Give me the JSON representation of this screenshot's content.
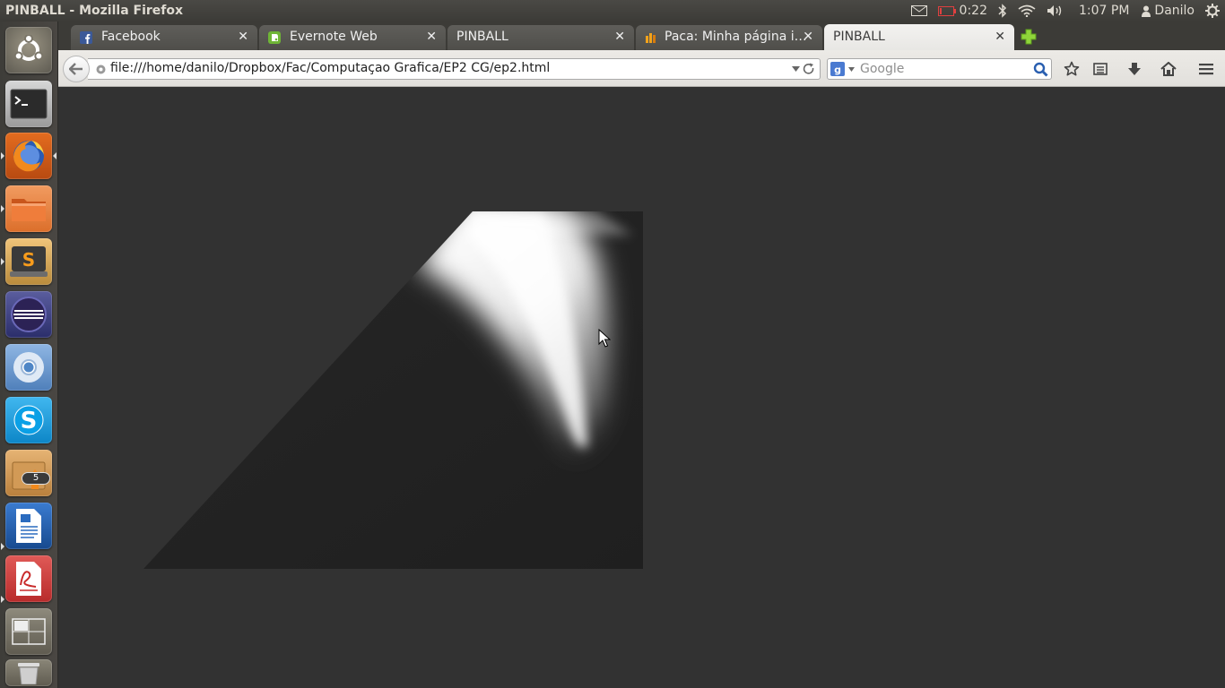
{
  "panel": {
    "window_title": "PINBALL - Mozilla Firefox",
    "battery_time": "0:22",
    "clock": "1:07 PM",
    "user": "Danilo"
  },
  "launcher": {
    "items": [
      {
        "name": "dash-home",
        "icon": "ubuntu-logo-icon"
      },
      {
        "name": "terminal",
        "icon": "terminal-icon"
      },
      {
        "name": "firefox",
        "icon": "firefox-icon",
        "running": true,
        "focused": true
      },
      {
        "name": "files",
        "icon": "folder-icon",
        "running": true
      },
      {
        "name": "sublime-text",
        "icon": "sublime-text-icon",
        "running": true
      },
      {
        "name": "eclipse",
        "icon": "eclipse-icon"
      },
      {
        "name": "chromium",
        "icon": "chromium-icon"
      },
      {
        "name": "skype",
        "icon": "skype-icon"
      },
      {
        "name": "software-updater",
        "icon": "software-updater-icon",
        "badge": "5"
      },
      {
        "name": "libreoffice-writer",
        "icon": "writer-icon",
        "running": true
      },
      {
        "name": "document-viewer",
        "icon": "pdf-viewer-icon",
        "running": true
      },
      {
        "name": "workspace-switcher",
        "icon": "workspace-icon"
      },
      {
        "name": "trash",
        "icon": "trash-icon"
      }
    ]
  },
  "browser": {
    "tabs": [
      {
        "label": "Facebook",
        "favicon": "facebook-icon",
        "active": false
      },
      {
        "label": "Evernote Web",
        "favicon": "evernote-icon",
        "active": false
      },
      {
        "label": "PINBALL",
        "favicon": "",
        "active": false
      },
      {
        "label": "Paca: Minha página i…",
        "favicon": "paca-icon",
        "active": false
      },
      {
        "label": "PINBALL",
        "favicon": "",
        "active": true
      }
    ],
    "url": "file:///home/danilo/Dropbox/Fac/Computaçao Grafica/EP2 CG/ep2.html",
    "search_placeholder": "Google"
  },
  "colors": {
    "page_background": "#323232",
    "panel": "#3c3b37",
    "toolbar": "#e6e4e0"
  }
}
